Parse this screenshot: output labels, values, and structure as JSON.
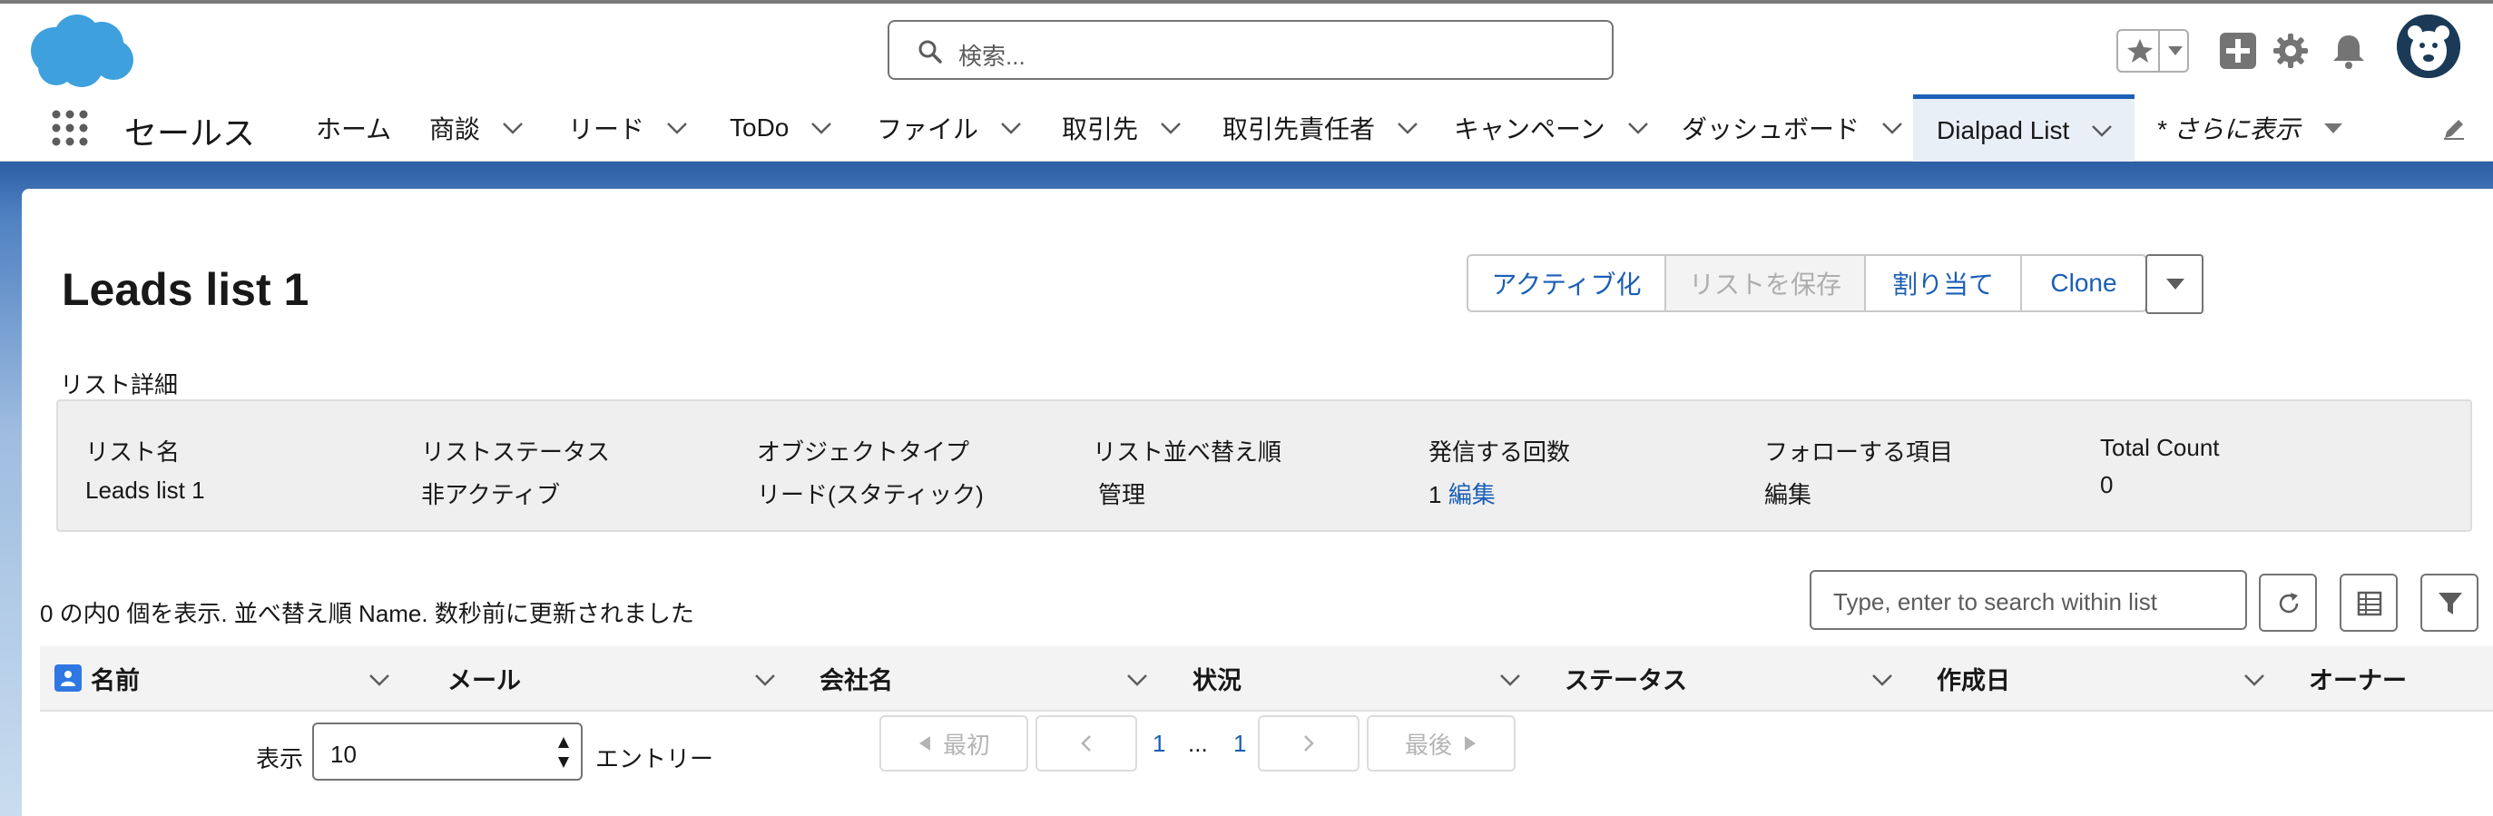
{
  "header": {
    "search_placeholder": "検索..."
  },
  "nav": {
    "app_name": "セールス",
    "items": [
      {
        "label": "ホーム"
      },
      {
        "label": "商談"
      },
      {
        "label": "リード"
      },
      {
        "label": "ToDo"
      },
      {
        "label": "ファイル"
      },
      {
        "label": "取引先"
      },
      {
        "label": "取引先責任者"
      },
      {
        "label": "キャンペーン"
      },
      {
        "label": "ダッシュボード"
      },
      {
        "label": "Dialpad List"
      },
      {
        "label": "* さらに表示"
      }
    ],
    "active_item": "Dialpad List"
  },
  "page": {
    "title": "Leads list 1",
    "buttons": {
      "activate": "アクティブ化",
      "save_list": "リストを保存",
      "assign": "割り当て",
      "clone": "Clone"
    },
    "detail_section_label": "リスト詳細",
    "details": [
      {
        "label": "リスト名",
        "value": "Leads list 1"
      },
      {
        "label": "リストステータス",
        "value": "非アクティブ"
      },
      {
        "label": "オブジェクトタイプ",
        "value": "リード(スタティック)"
      },
      {
        "label": "リスト並べ替え順",
        "value": "管理"
      },
      {
        "label": "発信する回数",
        "value": "1",
        "link": "編集"
      },
      {
        "label": "フォローする項目",
        "value": "編集"
      },
      {
        "label": "Total Count",
        "value": "0"
      }
    ]
  },
  "list": {
    "status_line": "0 の内0 個を表示. 並べ替え順 Name. 数秒前に更新されました",
    "search_placeholder": "Type, enter to search within list",
    "columns": [
      "名前",
      "メール",
      "会社名",
      "状況",
      "ステータス",
      "作成日",
      "オーナー"
    ]
  },
  "pagination": {
    "show_label": "表示",
    "entries_value": "10",
    "entries_label": "エントリー",
    "first_label": "最初",
    "last_label": "最後",
    "page_current": "1",
    "ellipsis": "...",
    "page_last": "1"
  },
  "colors": {
    "brand_blue": "#1b5fb6",
    "banner_blue": "#2c5ea5",
    "cloud_blue": "#3ea0dd"
  }
}
